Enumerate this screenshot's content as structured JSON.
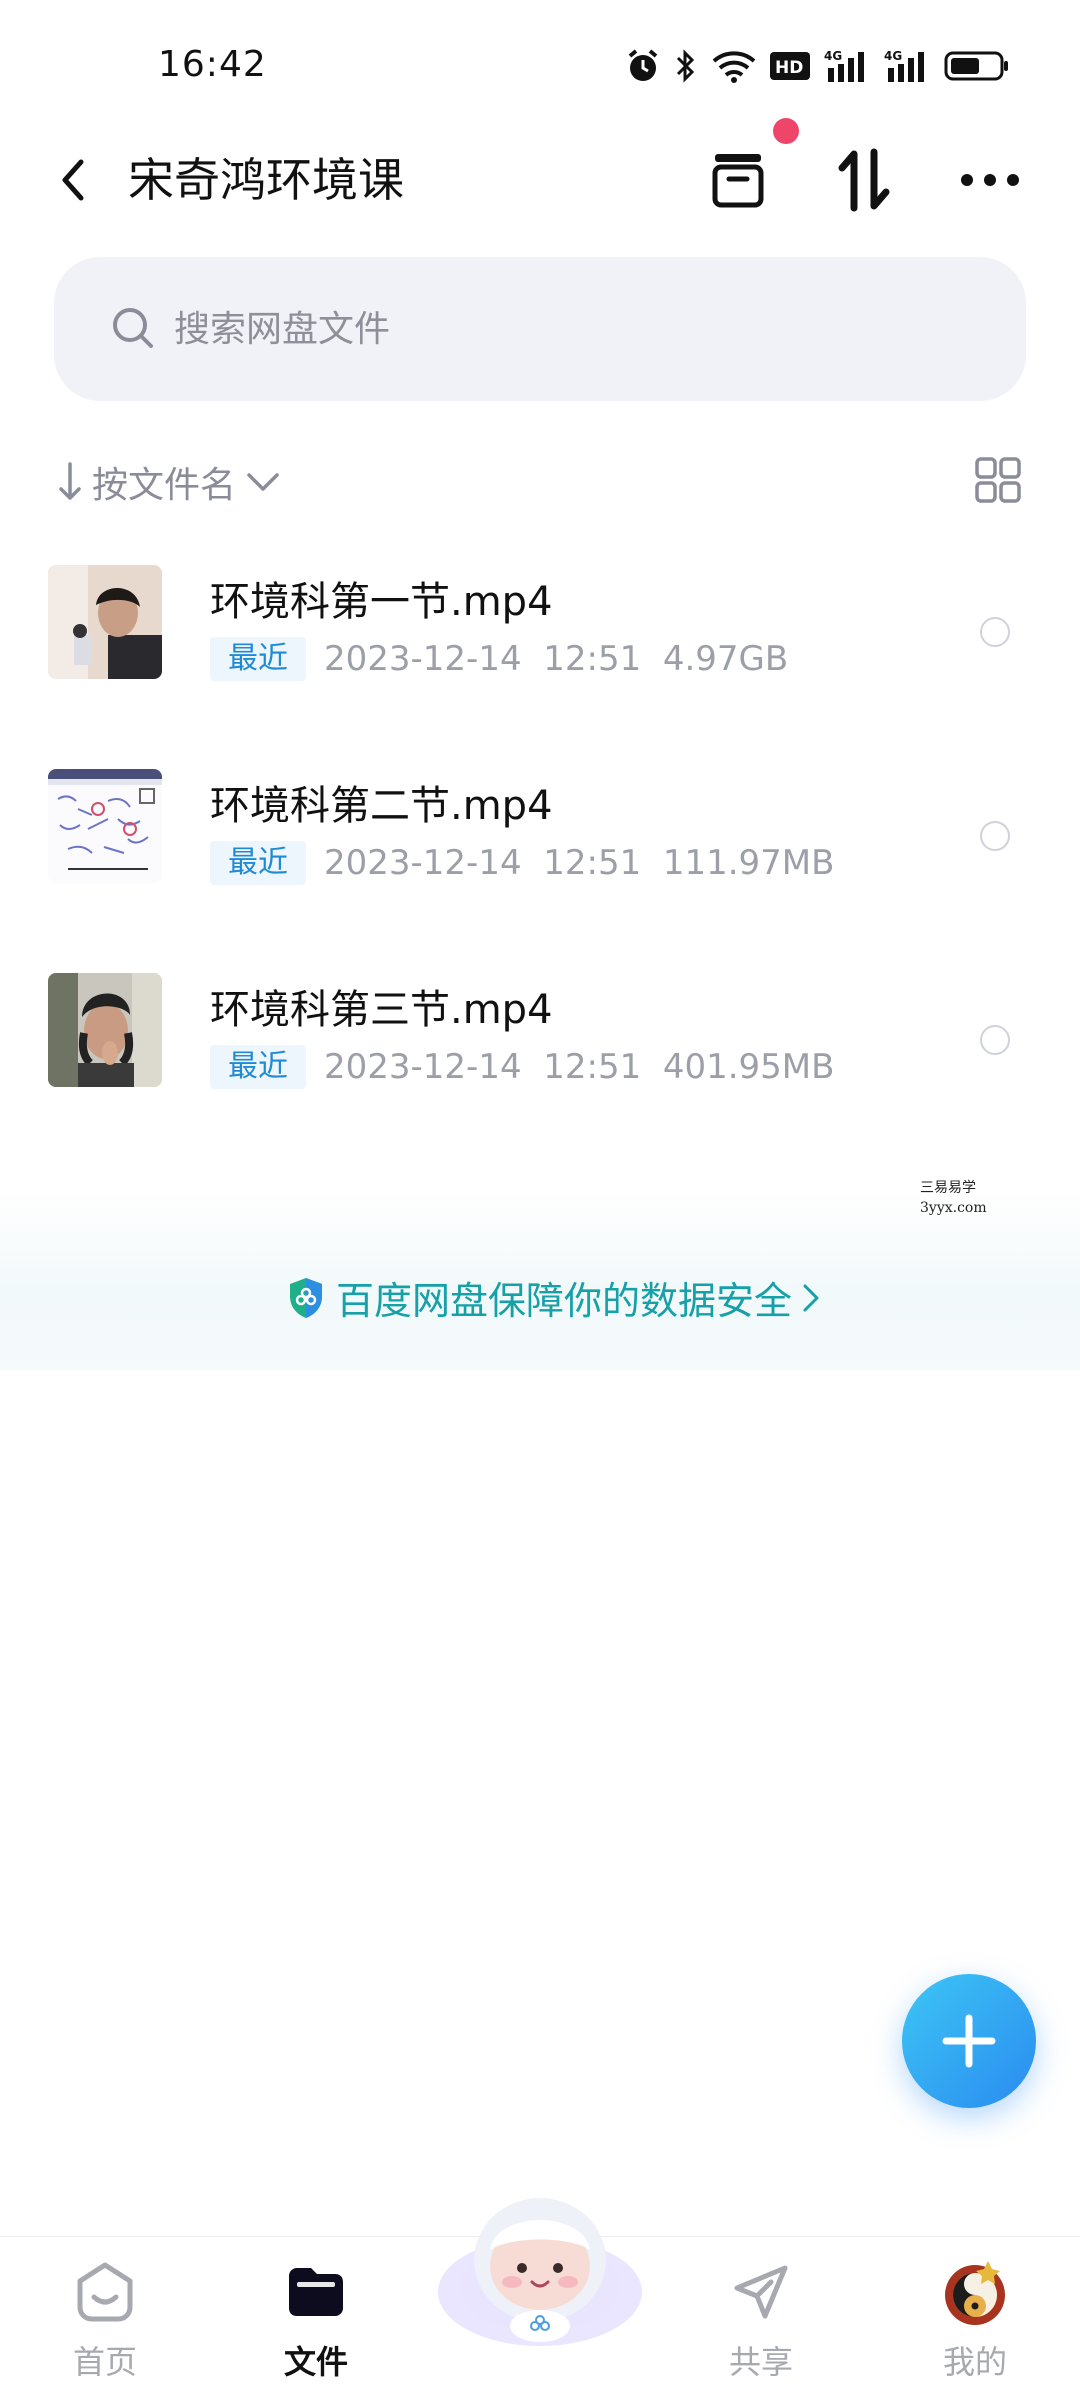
{
  "status_bar": {
    "time": "16:42"
  },
  "header": {
    "title": "宋奇鸿环境课"
  },
  "search": {
    "placeholder": "搜索网盘文件"
  },
  "sort": {
    "label": "按文件名"
  },
  "files": [
    {
      "name": "环境科第一节.mp4",
      "badge": "最近",
      "date": "2023-12-14",
      "time": "12:51",
      "size": "4.97GB"
    },
    {
      "name": "环境科第二节.mp4",
      "badge": "最近",
      "date": "2023-12-14",
      "time": "12:51",
      "size": "111.97MB"
    },
    {
      "name": "环境科第三节.mp4",
      "badge": "最近",
      "date": "2023-12-14",
      "time": "12:51",
      "size": "401.95MB"
    }
  ],
  "watermark": {
    "line1": "三易易学",
    "line2": "3yyx.com"
  },
  "banner": {
    "text": "百度网盘保障你的数据安全"
  },
  "nav": [
    {
      "label": "首页"
    },
    {
      "label": "文件"
    },
    {
      "label": "共享"
    },
    {
      "label": "我的"
    }
  ],
  "colors": {
    "accent": "#1f8bd6",
    "banner_text": "#16a0a8",
    "badge_dot": "#f0456a",
    "fab": "#2a8bf0"
  }
}
